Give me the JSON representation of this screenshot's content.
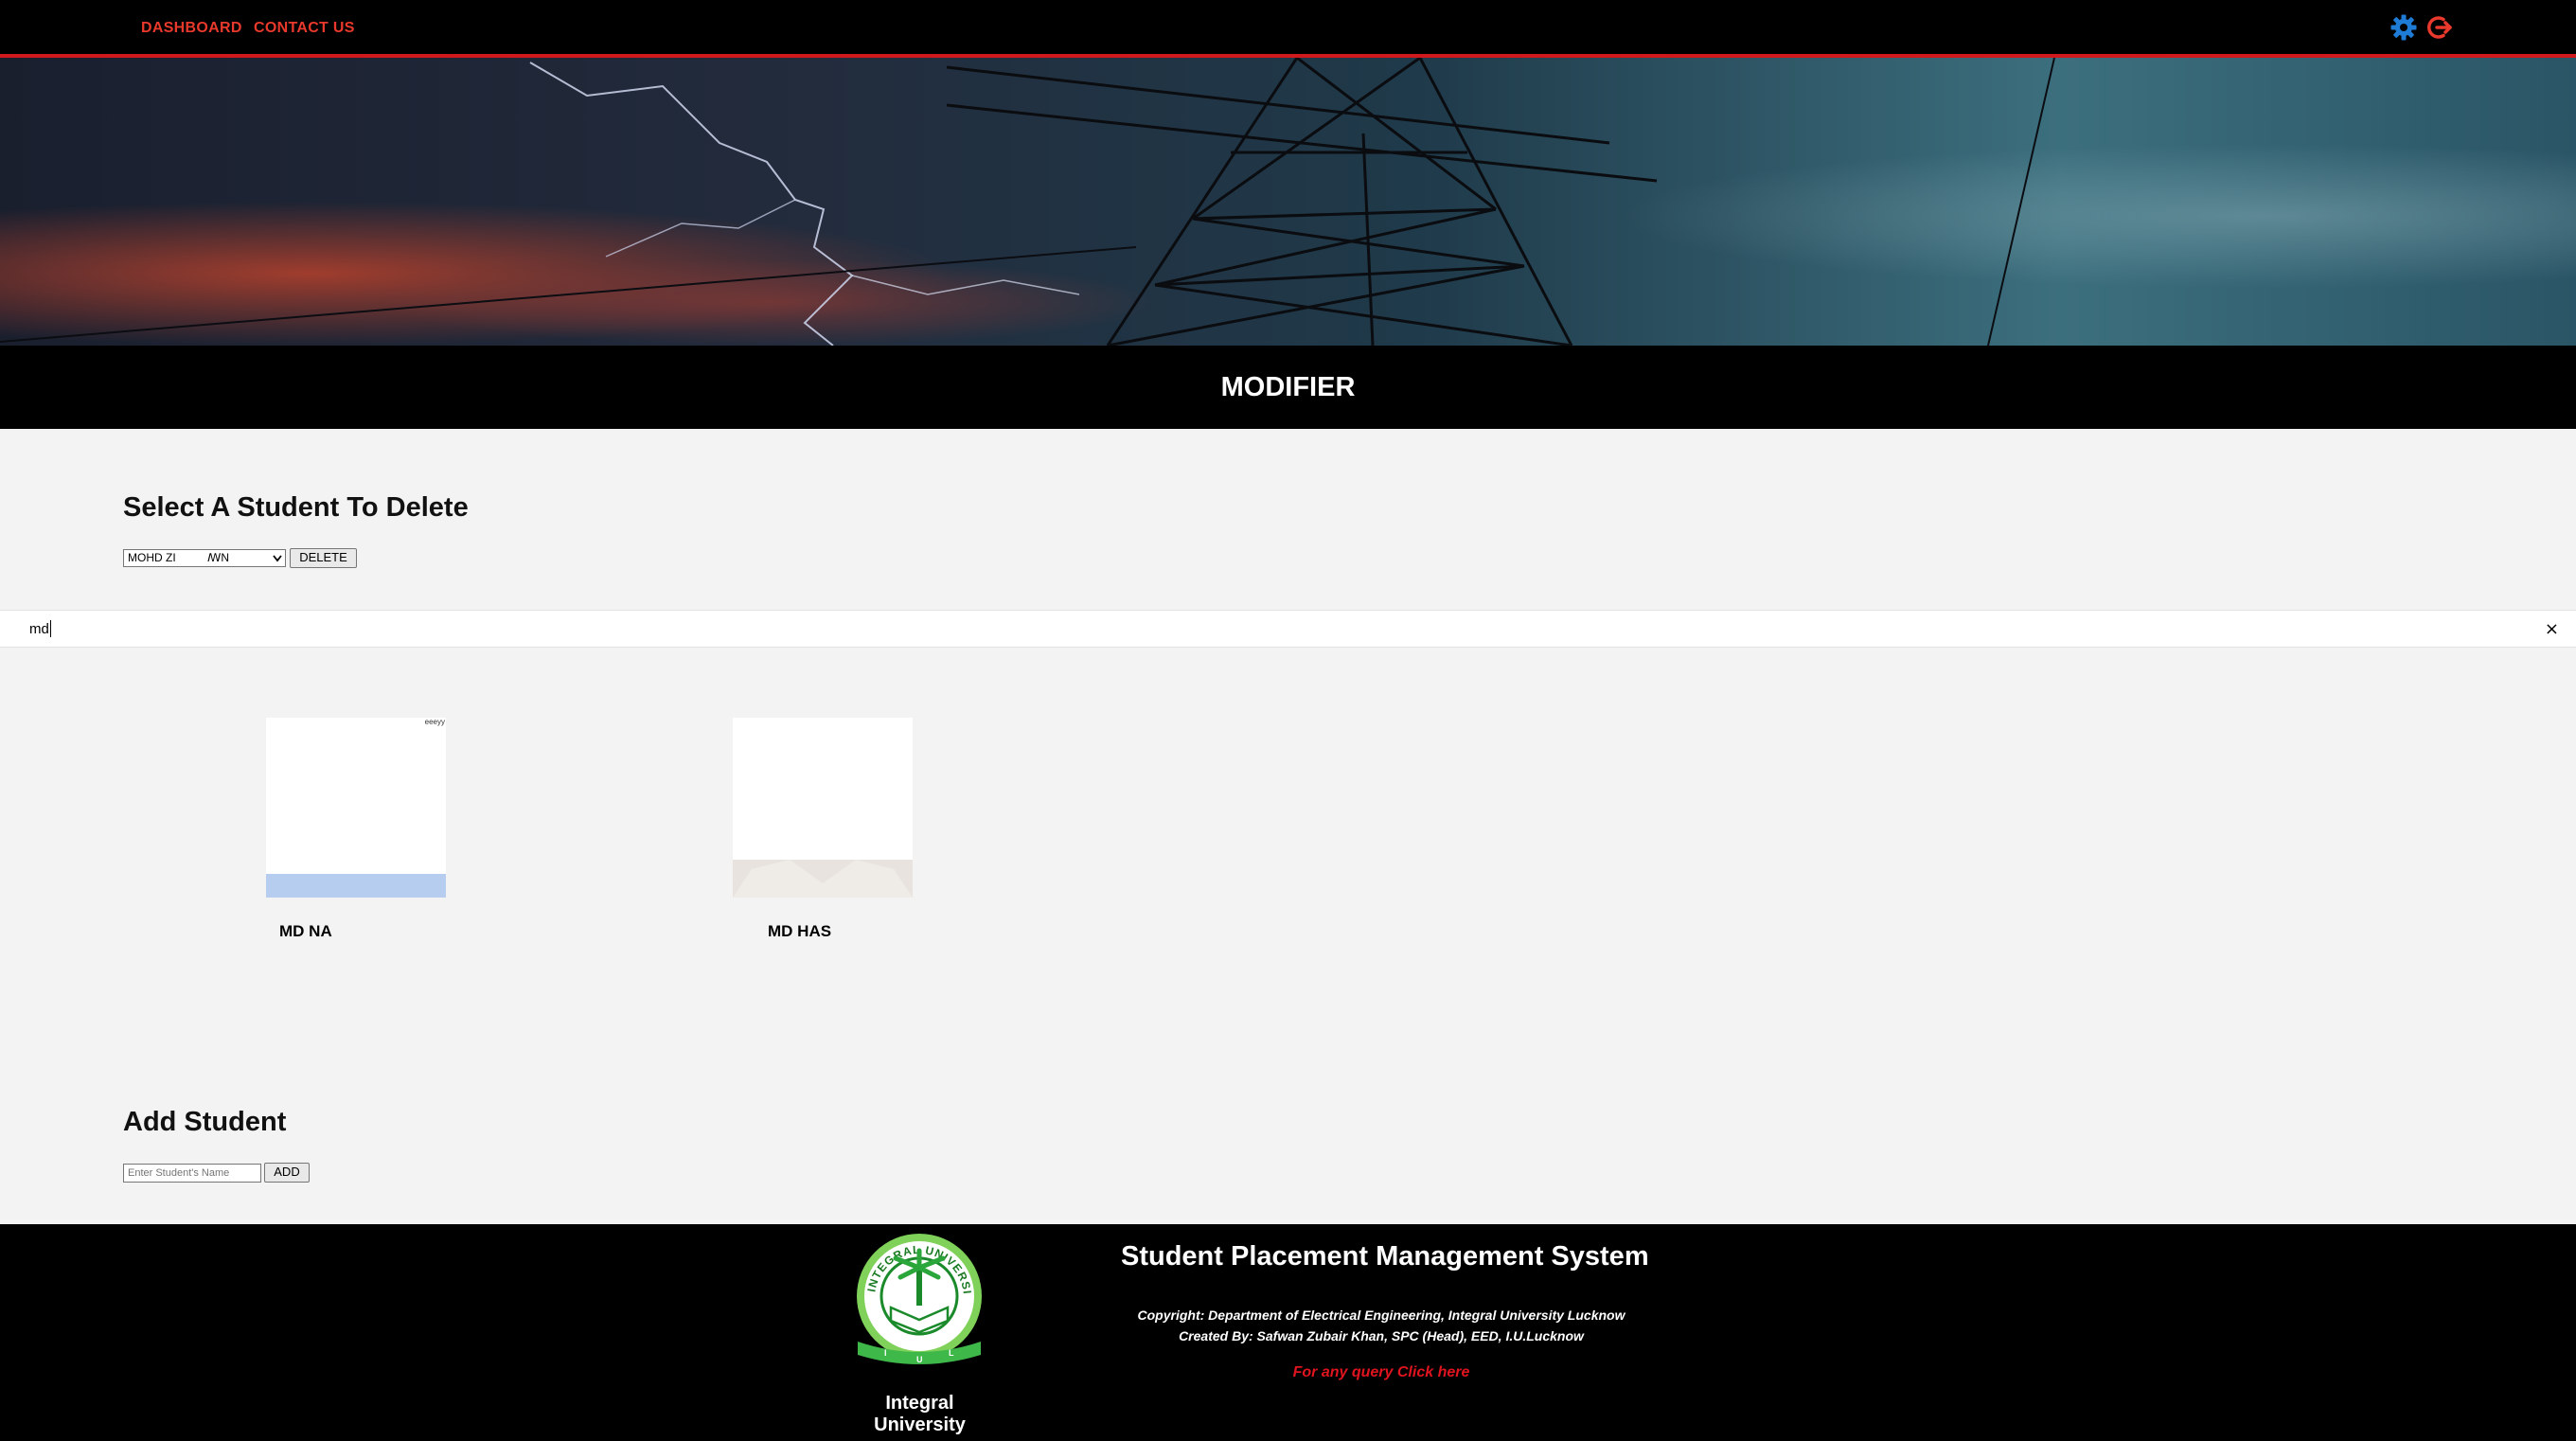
{
  "nav": {
    "links": [
      "DASHBOARD",
      "CONTACT US"
    ],
    "icons": [
      "settings-gear-icon",
      "logout-icon"
    ],
    "accent_color": "#e8392c",
    "border_color": "#d0191d"
  },
  "page": {
    "title": "MODIFIER"
  },
  "delete_section": {
    "heading": "Select A Student To Delete",
    "selected_value": "MOHD ZI          ꟿN",
    "delete_label": "DELETE"
  },
  "search": {
    "value": "md",
    "clear_symbol": "×"
  },
  "results": [
    {
      "name": "MD NA",
      "photo_caption": "eeeyy"
    },
    {
      "name": "MD HAS"
    }
  ],
  "add_section": {
    "heading": "Add Student",
    "input_placeholder": "Enter Student's Name",
    "add_label": "ADD"
  },
  "footer": {
    "system_title": "Student Placement Management System",
    "copyright": "Copyright: Department of Electrical Engineering, Integral University Lucknow",
    "created_by": "Created By: Safwan Zubair Khan, SPC (Head), EED, I.U.Lucknow",
    "query_link": "For any query Click here",
    "university_name": "Integral University",
    "logo_text_top": "INTEGRAL UNIVERSITY, LUCKNOW",
    "logo_letters": [
      "I",
      "U",
      "L"
    ],
    "query_link_color": "#e0141e"
  }
}
